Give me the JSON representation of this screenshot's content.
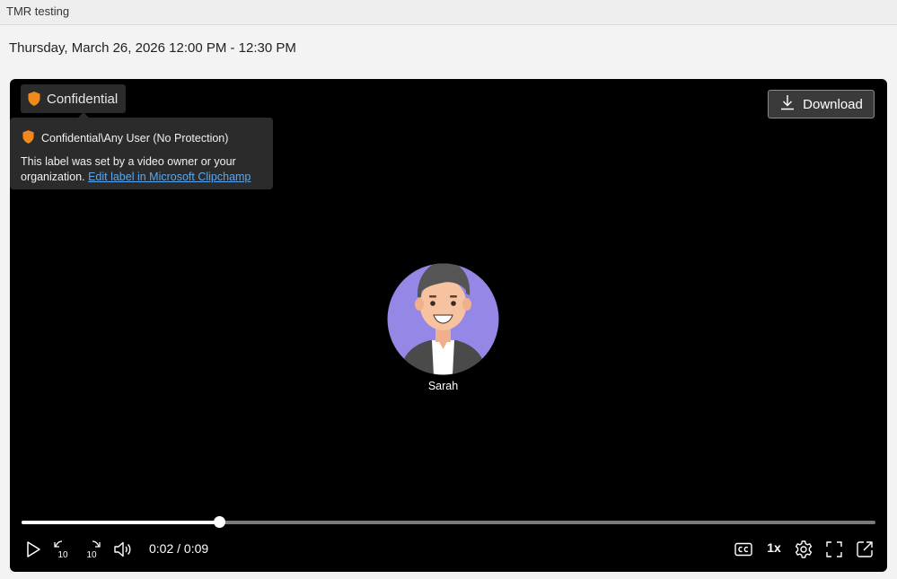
{
  "window": {
    "title": "TMR testing"
  },
  "meeting": {
    "datetime": "Thursday, March 26, 2026 12:00 PM - 12:30 PM"
  },
  "sensitivity": {
    "label": "Confidential",
    "tooltip_title": "Confidential\\Any User (No Protection)",
    "tooltip_text": "This label was set by a video owner or your organization.",
    "tooltip_link": "Edit label in Microsoft Clipchamp",
    "shield_color": "#f08a1c"
  },
  "download": {
    "label": "Download"
  },
  "participant": {
    "name": "Sarah",
    "avatar_bg": "#9487e6"
  },
  "playback": {
    "current_time": "0:02",
    "duration": "0:09",
    "time_text": "0:02 / 0:09",
    "progress_fraction": 0.231,
    "speed_label": "1x",
    "skip_back_label": "10",
    "skip_forward_label": "10"
  },
  "icons": {
    "play": "play-icon",
    "rewind": "skip-back-10-icon",
    "forward": "skip-forward-10-icon",
    "volume": "volume-icon",
    "captions": "closed-captions-icon",
    "settings": "gear-icon",
    "fullscreen": "fullscreen-icon",
    "popout": "pop-out-icon",
    "download": "download-icon",
    "shield": "shield-icon"
  }
}
